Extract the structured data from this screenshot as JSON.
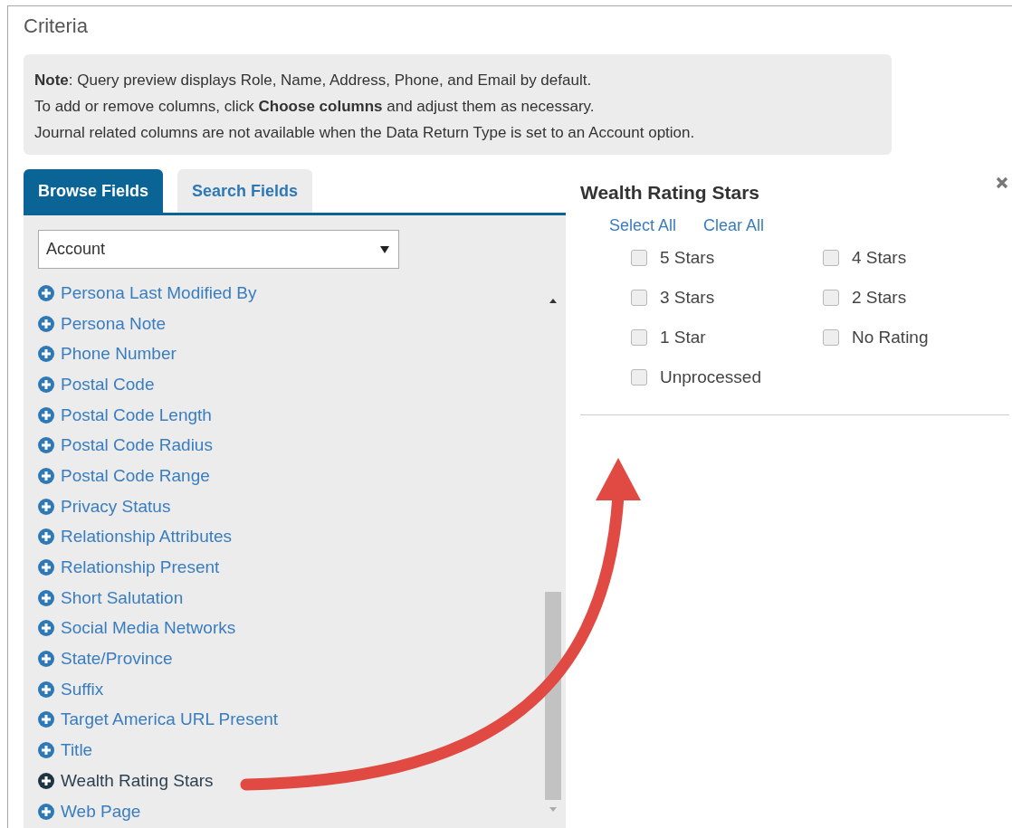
{
  "title": "Criteria",
  "note": [
    "**Note**: Query preview displays Role, Name, Address, Phone, and Email by default.",
    "To add or remove columns, click **Choose columns** and adjust them as necessary.",
    "Journal related columns are not available when the Data Return Type is set to an Account option."
  ],
  "tabs": [
    {
      "label": "Browse Fields",
      "selected": true
    },
    {
      "label": "Search Fields",
      "selected": false
    }
  ],
  "field_category": {
    "value": "Account"
  },
  "fields": [
    {
      "label": "Persona Last Modified By",
      "selected": false
    },
    {
      "label": "Persona Note",
      "selected": false
    },
    {
      "label": "Phone Number",
      "selected": false
    },
    {
      "label": "Postal Code",
      "selected": false
    },
    {
      "label": "Postal Code Length",
      "selected": false
    },
    {
      "label": "Postal Code Radius",
      "selected": false
    },
    {
      "label": "Postal Code Range",
      "selected": false
    },
    {
      "label": "Privacy Status",
      "selected": false
    },
    {
      "label": "Relationship Attributes",
      "selected": false
    },
    {
      "label": "Relationship Present",
      "selected": false
    },
    {
      "label": "Short Salutation",
      "selected": false
    },
    {
      "label": "Social Media Networks",
      "selected": false
    },
    {
      "label": "State/Province",
      "selected": false
    },
    {
      "label": "Suffix",
      "selected": false
    },
    {
      "label": "Target America URL Present",
      "selected": false
    },
    {
      "label": "Title",
      "selected": false
    },
    {
      "label": "Wealth Rating Stars",
      "selected": true
    },
    {
      "label": "Web Page",
      "selected": false
    }
  ],
  "filter_panel": {
    "title": "Wealth Rating Stars",
    "actions": [
      "Select All",
      "Clear All"
    ],
    "options": [
      {
        "label": "5 Stars",
        "checked": false
      },
      {
        "label": "4 Stars",
        "checked": false
      },
      {
        "label": "3 Stars",
        "checked": false
      },
      {
        "label": "2 Stars",
        "checked": false
      },
      {
        "label": "1 Star",
        "checked": false
      },
      {
        "label": "No Rating",
        "checked": false
      },
      {
        "label": "Unprocessed",
        "checked": false
      }
    ]
  }
}
